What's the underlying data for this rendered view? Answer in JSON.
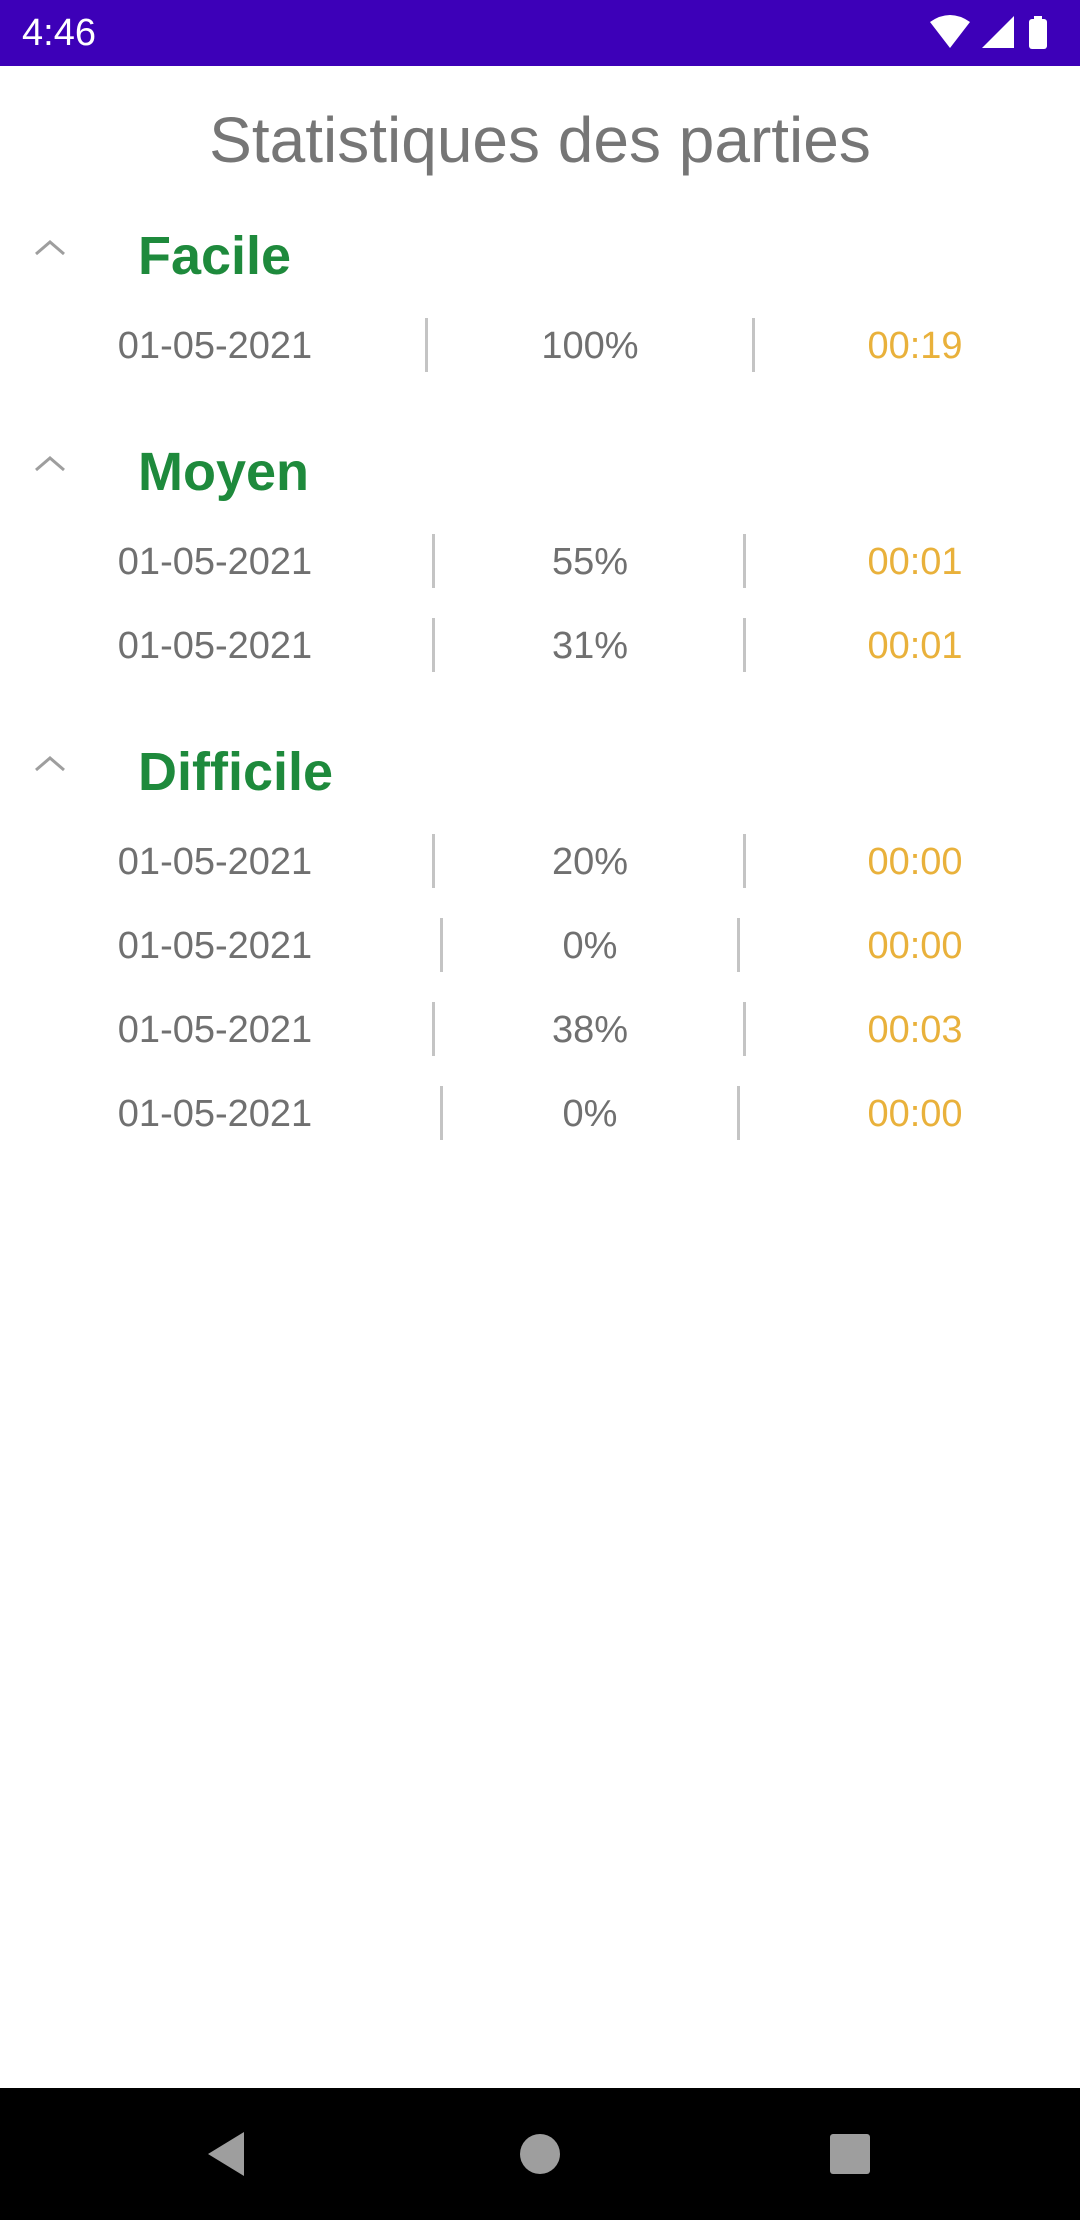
{
  "status_bar": {
    "time": "4:46",
    "icons": [
      "wifi-icon",
      "signal-icon",
      "battery-icon"
    ],
    "background_color": "#3d00b8"
  },
  "page": {
    "title": "Statistiques des parties"
  },
  "colors": {
    "section_label": "#1e8a3c",
    "time_value": "#e9b13b",
    "text_gray": "#707070"
  },
  "sections": [
    {
      "label": "Facile",
      "rows": [
        {
          "date": "01-05-2021",
          "percent": "100%",
          "time": "00:19"
        }
      ]
    },
    {
      "label": "Moyen",
      "rows": [
        {
          "date": "01-05-2021",
          "percent": "55%",
          "time": "00:01"
        },
        {
          "date": "01-05-2021",
          "percent": "31%",
          "time": "00:01"
        }
      ]
    },
    {
      "label": "Difficile",
      "rows": [
        {
          "date": "01-05-2021",
          "percent": "20%",
          "time": "00:00"
        },
        {
          "date": "01-05-2021",
          "percent": "0%",
          "time": "00:00"
        },
        {
          "date": "01-05-2021",
          "percent": "38%",
          "time": "00:03"
        },
        {
          "date": "01-05-2021",
          "percent": "0%",
          "time": "00:00"
        }
      ]
    }
  ],
  "nav_bar": {
    "buttons": [
      "back-icon",
      "home-icon",
      "recents-icon"
    ]
  }
}
